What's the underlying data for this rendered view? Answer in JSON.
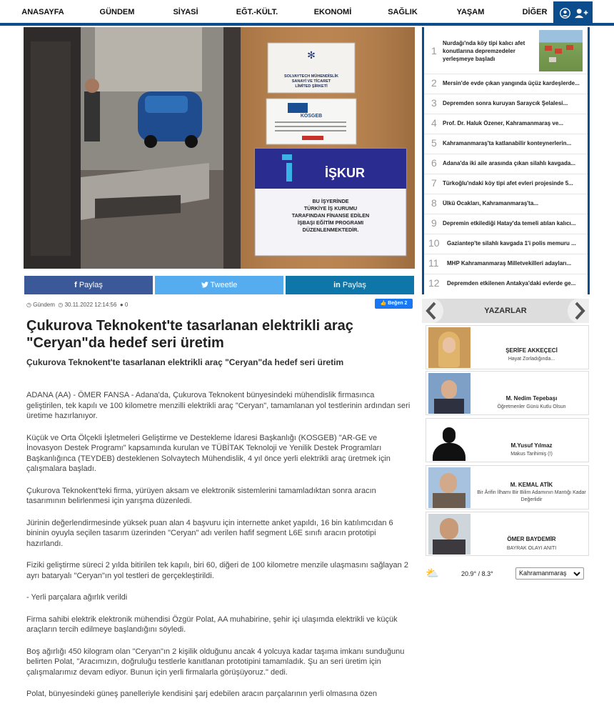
{
  "nav": {
    "items": [
      "ANASAYFA",
      "GÜNDEM",
      "SİYASİ",
      "EĞT.-KÜLT.",
      "EKONOMİ",
      "SAĞLIK",
      "YAŞAM",
      "DİĞER"
    ]
  },
  "hero": {
    "sign_company": "SOLVAYTECH MÜHENDİSLİK SANAYİ VE TİCARET LİMİTED ŞİRKETİ",
    "sign_kosgeb": "KOSGEB",
    "sign_iskur": "İŞKUR",
    "sign_iskur_text": "BU İŞYERİNDE TÜRKİYE İŞ KURUMU TARAFINDAN FİNANSE EDİLEN İŞBAŞI EĞİTİM PROGRAMI DÜZENLENMEKTEDİR."
  },
  "share": {
    "facebook": "Paylaş",
    "twitter": "Tweetle",
    "linkedin": "Paylaş"
  },
  "meta": {
    "category": "Gündem",
    "date": "30.11.2022 12:14:56",
    "comments": "0",
    "like": "Beğen 2"
  },
  "article": {
    "title": "Çukurova Teknokent'te tasarlanan elektrikli araç \"Ceryan\"da hedef seri üretim",
    "subtitle": "Çukurova Teknokent'te tasarlanan elektrikli araç \"Ceryan\"da hedef seri üretim",
    "paragraphs": [
      "ADANA (AA) - ÖMER FANSA - Adana'da, Çukurova Teknokent bünyesindeki mühendislik firmasınca geliştirilen, tek kapılı ve 100 kilometre menzilli elektrikli araç \"Ceryan\", tamamlanan yol testlerinin ardından seri üretime hazırlanıyor.",
      "Küçük ve Orta Ölçekli İşletmeleri Geliştirme ve Destekleme İdaresi Başkanlığı (KOSGEB) \"AR-GE ve İnovasyon Destek Programı\" kapsamında kurulan ve TÜBİTAK Teknoloji ve Yenilik Destek Programları Başkanlığınca (TEYDEB) desteklenen Solvaytech Mühendislik, 4 yıl önce yerli elektrikli araç üretmek için çalışmalara başladı.",
      "Çukurova Teknokent'teki firma, yürüyen aksam ve elektronik sistemlerini tamamladıktan sonra aracın tasarımının belirlenmesi için yarışma düzenledi.",
      "Jürinin değerlendirmesinde yüksek puan alan 4 başvuru için internette anket yapıldı, 16 bin katılımcıdan 6 bininin oyuyla seçilen tasarım üzerinden \"Ceryan\" adı verilen hafif segment L6E sınıfı aracın prototipi hazırlandı.",
      "Fiziki geliştirme süreci 2 yılda bitirilen tek kapılı, biri 60, diğeri de 100 kilometre menzile ulaşmasını sağlayan 2 ayrı bataryalı \"Ceryan\"ın yol testleri de gerçekleştirildi.",
      "- Yerli parçalara ağırlık verildi",
      "Firma sahibi elektrik elektronik mühendisi Özgür Polat, AA muhabirine, şehir içi ulaşımda elektrikli ve küçük araçların tercih edilmeye başlandığını söyledi.",
      "Boş ağırlığı 450 kilogram olan \"Ceryan\"ın 2 kişilik olduğunu ancak 4 yolcuya kadar taşıma imkanı sunduğunu belirten Polat, \"Aracımızın, doğruluğu testlerle kanıtlanan prototipini tamamladık. Şu an seri üretim için çalışmalarımız devam ediyor. Bunun için yerli firmalarla görüşüyoruz.\" dedi.",
      "Polat, bünyesindeki güneş panelleriyle kendisini şarj edebilen aracın parçalarının yerli olmasına özen"
    ]
  },
  "news_list": [
    {
      "num": "1",
      "title": "Nurdağı'nda köy tipi kalıcı afet konutlarına depremzedeler yerleşmeye başladı"
    },
    {
      "num": "2",
      "title": "Mersin'de evde çıkan yangında üçüz kardeşlerde..."
    },
    {
      "num": "3",
      "title": "Depremden sonra kuruyan Saraycık Şelalesi..."
    },
    {
      "num": "4",
      "title": "Prof. Dr. Haluk Özener, Kahramanmaraş ve..."
    },
    {
      "num": "5",
      "title": "Kahramanmaraş'ta katlanabilir konteynerlerin..."
    },
    {
      "num": "6",
      "title": "Adana'da iki aile arasında çıkan silahlı kavgada..."
    },
    {
      "num": "7",
      "title": "Türkoğlu'ndaki köy tipi afet evleri projesinde 5..."
    },
    {
      "num": "8",
      "title": "Ülkü Ocakları, Kahramanmaraş'ta..."
    },
    {
      "num": "9",
      "title": "Depremin etkilediği Hatay'da temeli atılan kalıcı..."
    },
    {
      "num": "10",
      "title": "Gaziantep'te silahlı kavgada 1'i polis memuru ..."
    },
    {
      "num": "11",
      "title": "MHP Kahramanmaraş Milletvekilleri adayları..."
    },
    {
      "num": "12",
      "title": "Depremden etkilenen Antakya'daki evlerde ge..."
    }
  ],
  "writers_title": "YAZARLAR",
  "writers": [
    {
      "name": "ŞERİFE AKKEÇECİ",
      "article": "Hayat Zorladığında..."
    },
    {
      "name": "M. Nedim Tepebaşı",
      "article": "Öğretmenler Günü Kutlu Olsun"
    },
    {
      "name": "M.Yusuf Yılmaz",
      "article": "Makus Tarihimiş (!)"
    },
    {
      "name": "M. KEMAL ATİK",
      "article": "Bir Ârifin İlhamı Bir Bilim Adamının Mantığı Kadar Değerlidir"
    },
    {
      "name": "ÖMER BAYDEMİR",
      "article": "BAYRAK OLAYI ANITI"
    }
  ],
  "weather": {
    "temp": "20.9° / 8.3°",
    "city": "Kahramanmaraş"
  },
  "colors": {
    "brand": "#0b4d8c",
    "facebook": "#3b5998",
    "twitter": "#55acee",
    "linkedin": "#0e76a8"
  }
}
